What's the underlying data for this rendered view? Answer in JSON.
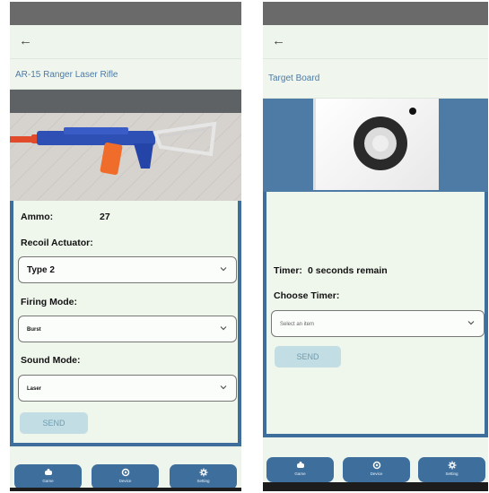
{
  "left_screen": {
    "back_icon": "arrow-left-icon",
    "title": "AR-15 Ranger Laser Rifle",
    "ammo_label": "Ammo:",
    "ammo_value": "27",
    "recoil_label": "Recoil Actuator:",
    "recoil_value": "Type 2",
    "firing_label": "Firing Mode:",
    "firing_value": "Burst",
    "sound_label": "Sound Mode:",
    "sound_value": "Laser",
    "send_label": "SEND"
  },
  "right_screen": {
    "back_icon": "arrow-left-icon",
    "title": "Target Board",
    "timer_label": "Timer:",
    "timer_value": "0 seconds remain",
    "choose_label": "Choose Timer:",
    "timer_placeholder": "Select an item",
    "send_label": "SEND"
  },
  "nav": {
    "items": [
      {
        "label": "Game",
        "icon": "game-icon"
      },
      {
        "label": "Device",
        "icon": "device-icon"
      },
      {
        "label": "Setting",
        "icon": "gear-icon"
      }
    ]
  },
  "colors": {
    "primary": "#3e6f9c",
    "background": "#eaf3e8",
    "title_text": "#4b7aa6",
    "send_button": "#c3dde4",
    "status_bar": "#6a6a6a"
  }
}
